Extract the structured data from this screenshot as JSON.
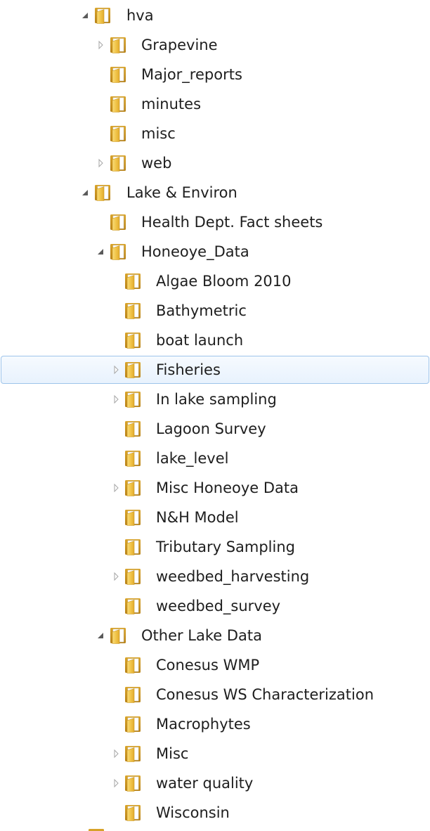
{
  "tree": {
    "selected_index": 12,
    "items": [
      {
        "label": "hva",
        "depth": 0,
        "expander": "expanded"
      },
      {
        "label": "Grapevine",
        "depth": 1,
        "expander": "collapsed"
      },
      {
        "label": "Major_reports",
        "depth": 1,
        "expander": "none"
      },
      {
        "label": "minutes",
        "depth": 1,
        "expander": "none"
      },
      {
        "label": "misc",
        "depth": 1,
        "expander": "none"
      },
      {
        "label": "web",
        "depth": 1,
        "expander": "collapsed"
      },
      {
        "label": "Lake & Environ",
        "depth": 0,
        "expander": "expanded"
      },
      {
        "label": "Health Dept. Fact sheets",
        "depth": 1,
        "expander": "none"
      },
      {
        "label": "Honeoye_Data",
        "depth": 1,
        "expander": "expanded"
      },
      {
        "label": "Algae Bloom 2010",
        "depth": 2,
        "expander": "none"
      },
      {
        "label": "Bathymetric",
        "depth": 2,
        "expander": "none"
      },
      {
        "label": "boat launch",
        "depth": 2,
        "expander": "none"
      },
      {
        "label": "Fisheries",
        "depth": 2,
        "expander": "collapsed"
      },
      {
        "label": "In lake sampling",
        "depth": 2,
        "expander": "collapsed"
      },
      {
        "label": "Lagoon Survey",
        "depth": 2,
        "expander": "none"
      },
      {
        "label": "lake_level",
        "depth": 2,
        "expander": "none"
      },
      {
        "label": "Misc Honeoye Data",
        "depth": 2,
        "expander": "collapsed"
      },
      {
        "label": "N&H Model",
        "depth": 2,
        "expander": "none"
      },
      {
        "label": "Tributary Sampling",
        "depth": 2,
        "expander": "none"
      },
      {
        "label": "weedbed_harvesting",
        "depth": 2,
        "expander": "collapsed"
      },
      {
        "label": "weedbed_survey",
        "depth": 2,
        "expander": "none"
      },
      {
        "label": "Other Lake Data",
        "depth": 1,
        "expander": "expanded"
      },
      {
        "label": "Conesus WMP",
        "depth": 2,
        "expander": "none"
      },
      {
        "label": "Conesus WS Characterization",
        "depth": 2,
        "expander": "none"
      },
      {
        "label": "Macrophytes",
        "depth": 2,
        "expander": "none"
      },
      {
        "label": "Misc",
        "depth": 2,
        "expander": "collapsed"
      },
      {
        "label": "water quality",
        "depth": 2,
        "expander": "collapsed"
      },
      {
        "label": "Wisconsin",
        "depth": 2,
        "expander": "none"
      }
    ]
  },
  "icons": {
    "folder": "folder-icon",
    "expanded": "expanded-triangle-icon",
    "collapsed": "collapsed-triangle-icon"
  },
  "colors": {
    "selection_border": "#9ec4ea",
    "selection_fill": "#e8f2fd",
    "folder": "#e8b93a",
    "text": "#1e1e1e"
  }
}
